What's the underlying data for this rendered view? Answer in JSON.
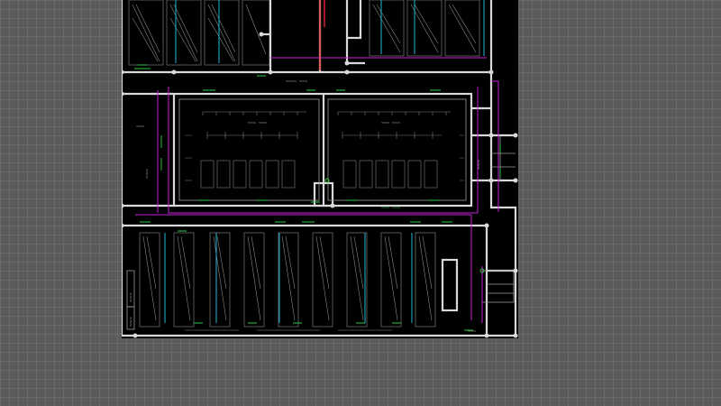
{
  "colors": {
    "canvas_background": "#5b5b5b",
    "canvas_grid": "#6a6a6a",
    "sheet_background": "#000000",
    "wall": "#d9d9d9",
    "duct_magenta": "#c21fd6",
    "pipe_cyan": "#1fb7d6",
    "pipe_red": "#e0262d",
    "fitting_green": "#2ecc40"
  },
  "labels": {
    "room_top": "~~~~ ~~~",
    "room_left": "~~~",
    "hall_left_title": "~~~ ~~~",
    "hall_right_title": "~~~ ~~~",
    "corridor_mid": "~~~ ~~~",
    "side_left_a": "~~~",
    "side_left_b": "~~~",
    "side_left_c": "~~~",
    "stair_note": "~~~",
    "bottom_right": "~~~"
  }
}
